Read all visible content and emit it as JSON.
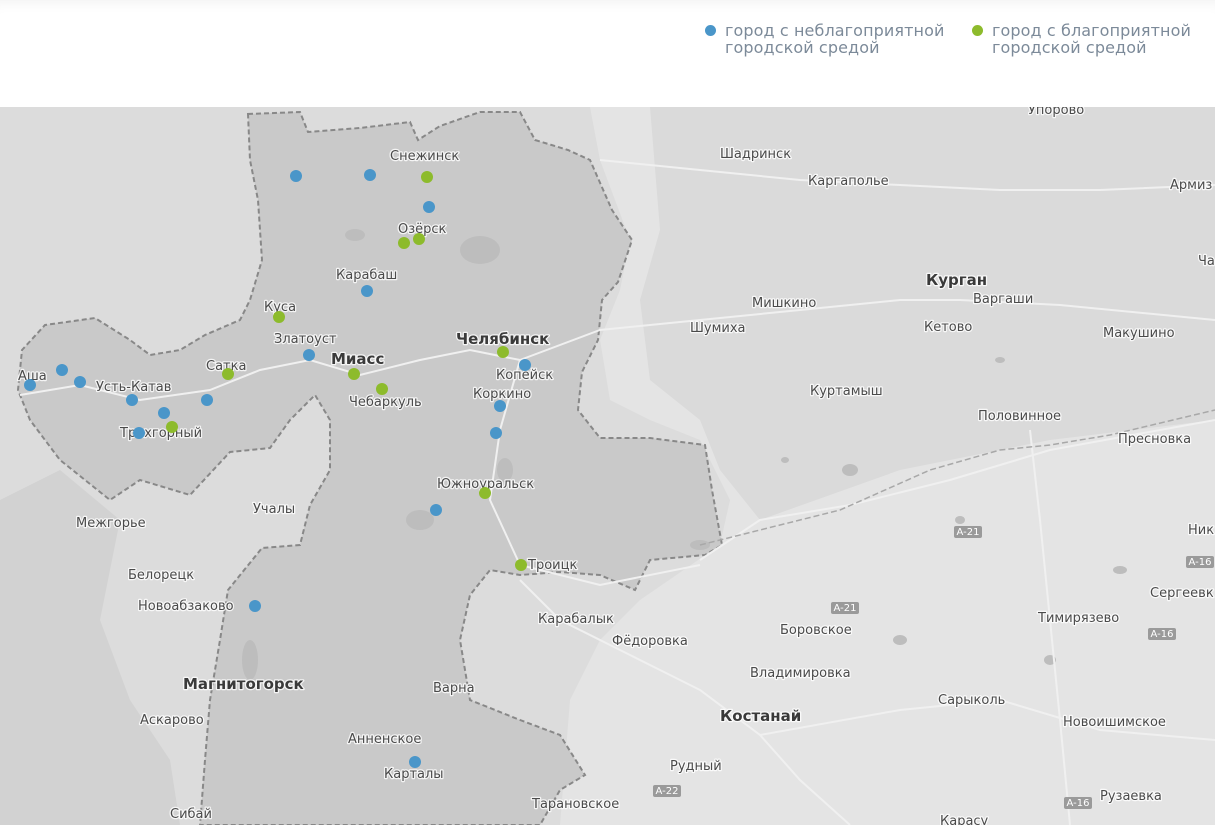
{
  "legend": {
    "unfavorable": {
      "line1": "город с неблагоприятной",
      "line2": "городской средой",
      "color": "#4a96c9"
    },
    "favorable": {
      "line1": "город с благоприятной",
      "line2": "городской средой",
      "color": "#8dbb2c"
    }
  },
  "map": {
    "region_color": "#c9c9c9",
    "land_color": "#dcdcdc",
    "cities": [
      {
        "name": "Упорово"
      },
      {
        "name": "Снежинск"
      },
      {
        "name": "Шадринск"
      },
      {
        "name": "Каргаполье"
      },
      {
        "name": "Армиз"
      },
      {
        "name": "Озёрск"
      },
      {
        "name": "Ча"
      },
      {
        "name": "Карабаш"
      },
      {
        "name": "Курган",
        "major": true
      },
      {
        "name": "Мишкино"
      },
      {
        "name": "Варгаши"
      },
      {
        "name": "Куса"
      },
      {
        "name": "Шумиха"
      },
      {
        "name": "Кетово"
      },
      {
        "name": "Златоуст"
      },
      {
        "name": "Челябинск",
        "major": true
      },
      {
        "name": "Макушино"
      },
      {
        "name": "Аша"
      },
      {
        "name": "Миасс",
        "major": true
      },
      {
        "name": "Сатка"
      },
      {
        "name": "Копейск"
      },
      {
        "name": "Усть-Катав"
      },
      {
        "name": "Куртамыш"
      },
      {
        "name": "Чебаркуль"
      },
      {
        "name": "Коркино"
      },
      {
        "name": "Половинное"
      },
      {
        "name": "Трехгорный"
      },
      {
        "name": "Пресновка"
      },
      {
        "name": "Южноуральск"
      },
      {
        "name": "Межгорье"
      },
      {
        "name": "Учалы"
      },
      {
        "name": "Ник"
      },
      {
        "name": "Троицк"
      },
      {
        "name": "Белорецк"
      },
      {
        "name": "Сергеевк"
      },
      {
        "name": "Новоабзаково"
      },
      {
        "name": "Карабалык"
      },
      {
        "name": "Тимирязево"
      },
      {
        "name": "Фёдоровка"
      },
      {
        "name": "Боровское"
      },
      {
        "name": "Владимировка"
      },
      {
        "name": "Магнитогорск",
        "major": true
      },
      {
        "name": "Варна"
      },
      {
        "name": "Сарыколь"
      },
      {
        "name": "Аскарово"
      },
      {
        "name": "Костанай",
        "major": true
      },
      {
        "name": "Новоишимское"
      },
      {
        "name": "Анненское"
      },
      {
        "name": "Рудный"
      },
      {
        "name": "Карталы"
      },
      {
        "name": "Рузаевка"
      },
      {
        "name": "Сибай"
      },
      {
        "name": "Тарановское"
      },
      {
        "name": "Карасу"
      }
    ],
    "roads": [
      "A-21",
      "A-16",
      "A-21",
      "A-16",
      "A-22",
      "A-16"
    ],
    "markers": [
      {
        "type": "unfavorable"
      },
      {
        "type": "unfavorable"
      },
      {
        "type": "favorable"
      },
      {
        "type": "unfavorable"
      },
      {
        "type": "favorable"
      },
      {
        "type": "favorable"
      },
      {
        "type": "unfavorable"
      },
      {
        "type": "favorable"
      },
      {
        "type": "unfavorable"
      },
      {
        "type": "favorable"
      },
      {
        "type": "unfavorable"
      },
      {
        "type": "favorable"
      },
      {
        "type": "favorable"
      },
      {
        "type": "unfavorable"
      },
      {
        "type": "unfavorable"
      },
      {
        "type": "unfavorable"
      },
      {
        "type": "unfavorable"
      },
      {
        "type": "unfavorable"
      },
      {
        "type": "unfavorable"
      },
      {
        "type": "unfavorable"
      },
      {
        "type": "unfavorable"
      },
      {
        "type": "favorable"
      },
      {
        "type": "unfavorable"
      },
      {
        "type": "favorable"
      },
      {
        "type": "unfavorable"
      },
      {
        "type": "favorable"
      },
      {
        "type": "unfavorable"
      },
      {
        "type": "favorable"
      },
      {
        "type": "unfavorable"
      }
    ]
  }
}
